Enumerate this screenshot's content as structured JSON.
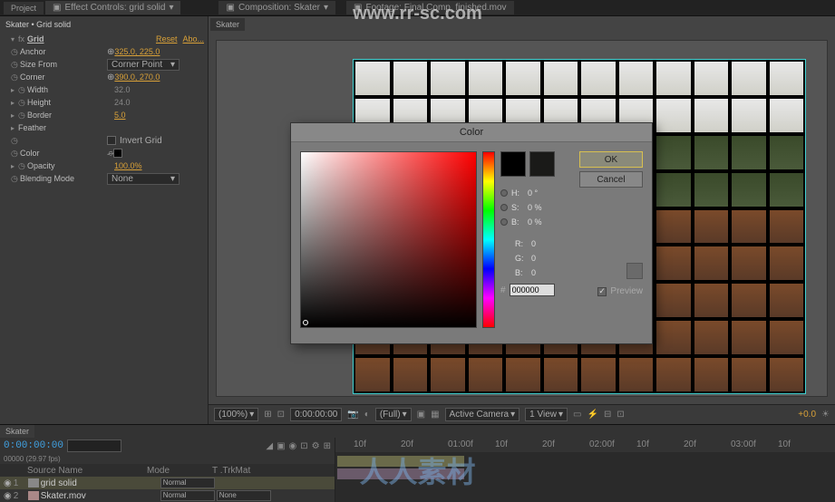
{
  "watermark": "www.rr-sc.com",
  "cn_watermark": "人人素材",
  "topbar": {
    "project": "Project",
    "effect_controls": "Effect Controls: grid solid",
    "composition": "Composition: Skater",
    "footage": "Footage:  Final Comp_finished.mov"
  },
  "ec": {
    "header": "Skater • Grid solid",
    "grid": "Grid",
    "reset": "Reset",
    "about": "Abo...",
    "anchor": "Anchor",
    "anchor_val": "325.0, 225.0",
    "size_from": "Size From",
    "size_from_val": "Corner Point",
    "corner": "Corner",
    "corner_val": "390.0, 270.0",
    "width": "Width",
    "width_val": "32.0",
    "height": "Height",
    "height_val": "24.0",
    "border": "Border",
    "border_val": "5.0",
    "feather": "Feather",
    "invert": "Invert Grid",
    "color": "Color",
    "opacity": "Opacity",
    "opacity_val": "100.0%",
    "blending": "Blending Mode",
    "blending_val": "None"
  },
  "comp_tab": "Skater",
  "viewer": {
    "zoom": "(100%)",
    "time": "0:00:00:00",
    "res": "(Full)",
    "camera": "Active Camera",
    "view": "1 View",
    "exposure": "+0.0"
  },
  "timeline": {
    "tab": "Skater",
    "timecode": "0:00:00:00",
    "frames": "00000 (29.97 fps)",
    "search_ph": "",
    "col_source": "Source Name",
    "col_mode": "Mode",
    "col_trk": "T .TrkMat",
    "layers": [
      {
        "num": "1",
        "name": "grid solid",
        "mode": "Normal",
        "trk": ""
      },
      {
        "num": "2",
        "name": "Skater.mov",
        "mode": "Normal",
        "trk": "None"
      }
    ],
    "ruler": [
      "10f",
      "20f",
      "01:00f",
      "10f",
      "20f",
      "02:00f",
      "10f",
      "20f",
      "03:00f",
      "10f"
    ]
  },
  "dialog": {
    "title": "Color",
    "ok": "OK",
    "cancel": "Cancel",
    "h": "H:",
    "h_val": "0 °",
    "s": "S:",
    "s_val": "0 %",
    "b": "B:",
    "b_val": "0 %",
    "r": "R:",
    "r_val": "0",
    "g": "G:",
    "g_val": "0",
    "bb": "B:",
    "bb_val": "0",
    "hex": "000000",
    "preview": "Preview"
  }
}
